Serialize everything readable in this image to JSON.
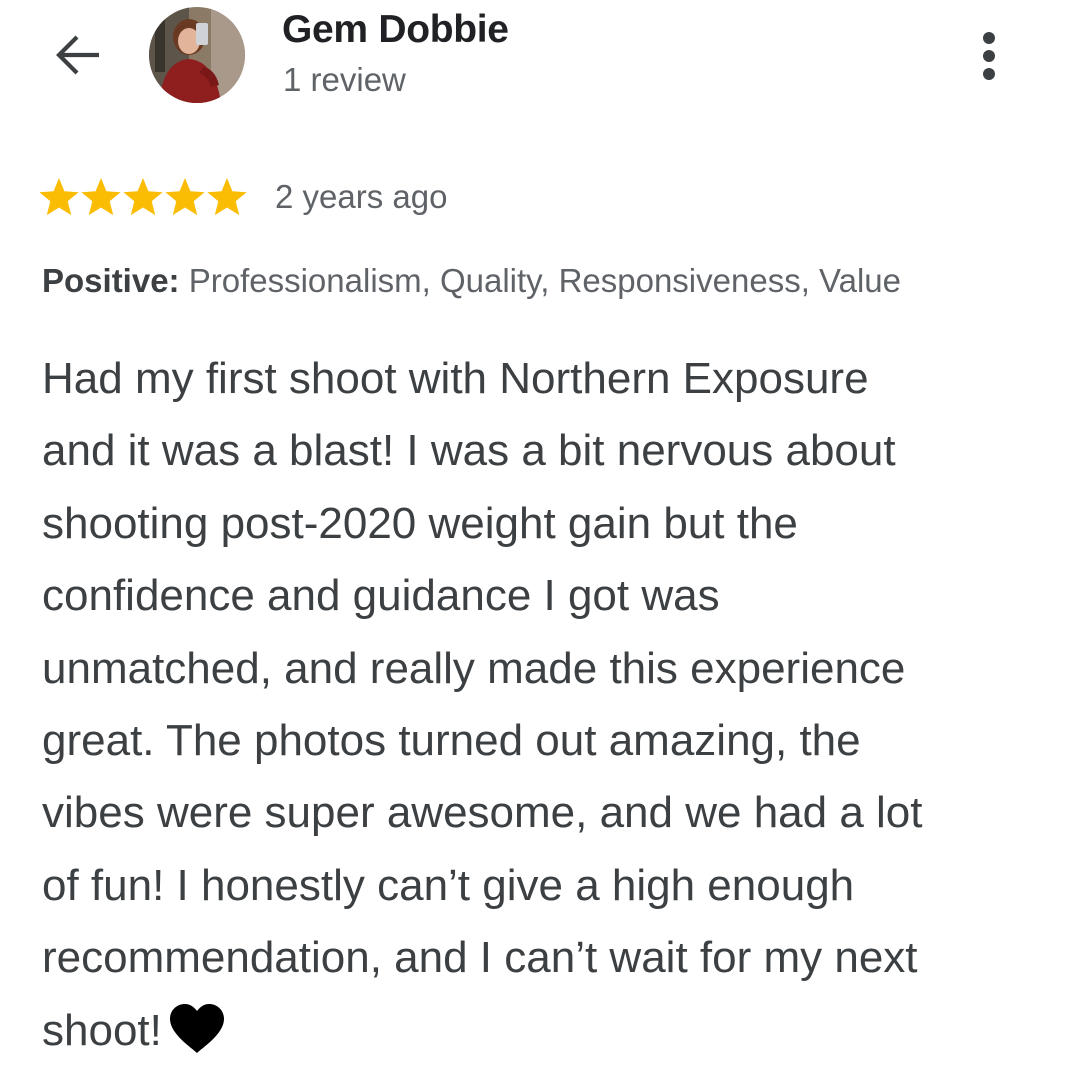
{
  "header": {
    "back_icon": "arrow-left-icon",
    "reviewer_name": "Gem Dobbie",
    "review_count": "1 review",
    "more_icon": "more-vertical-icon"
  },
  "review": {
    "rating": 5,
    "rating_max": 5,
    "star_color": "#fbbc04",
    "timestamp": "2 years ago",
    "attributes_label": "Positive:",
    "attributes_values": "Professionalism, Quality, Responsiveness, Value",
    "body_lines": [
      "Had my first shoot with Northern Exposure",
      "and it was a blast! I was a bit nervous about",
      "shooting post-2020 weight gain but the",
      "confidence and guidance I got was",
      "unmatched, and really made this experience",
      "great. The photos turned out amazing, the",
      "vibes were super awesome, and we had a lot",
      "of fun! I honestly can’t give a high enough",
      "recommendation, and I can’t wait for my next",
      "shoot!"
    ],
    "body_end_icon": "black-heart-icon"
  }
}
